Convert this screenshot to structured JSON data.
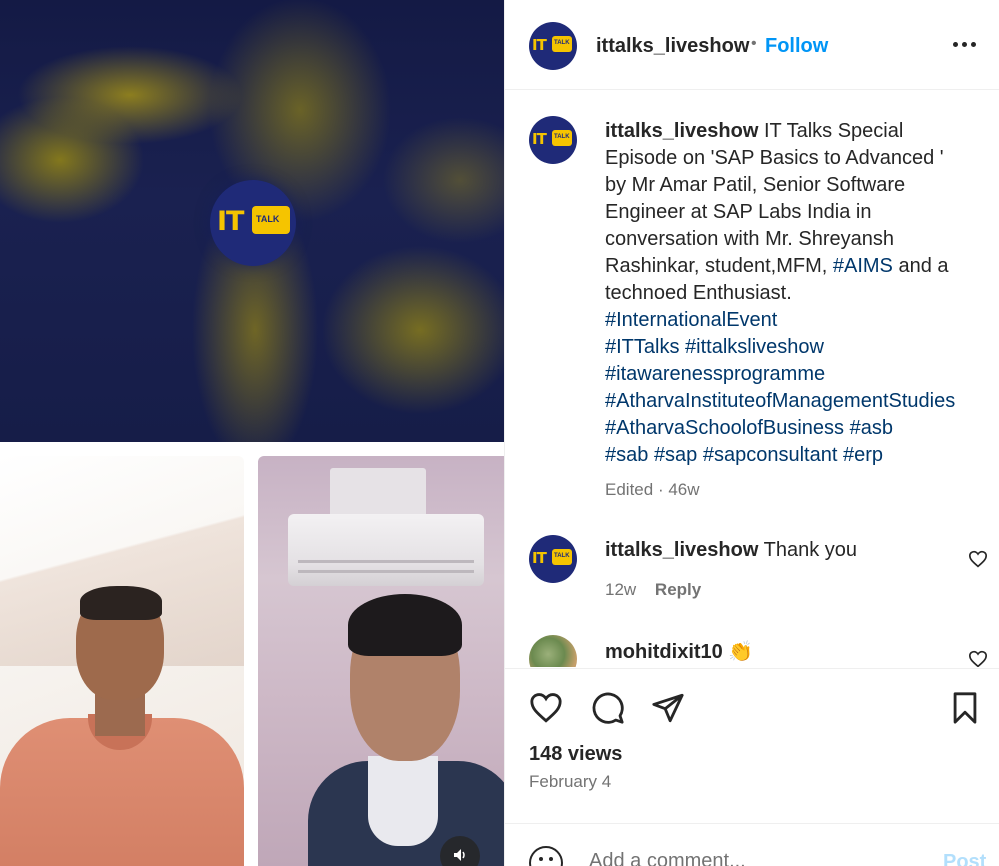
{
  "media": {
    "logo_word": "IT",
    "logo_bubble": "TALK",
    "mute_icon": "speaker-icon"
  },
  "header": {
    "username": "ittalks_liveshow",
    "separator": "•",
    "follow_label": "Follow",
    "more_icon": "more-options-icon"
  },
  "caption": {
    "username": "ittalks_liveshow",
    "text_part1": " IT Talks Special Episode on 'SAP Basics to Advanced ' by Mr Amar Patil, Senior Software Engineer at SAP Labs India in conversation with Mr. Shreyansh Rashinkar, student,MFM, ",
    "tag_aims": "#AIMS",
    "text_part2": " and a technoed Enthusiast.",
    "hashtags": [
      "#InternationalEvent",
      "#ITTalks",
      "#ittalksliveshow",
      "#itawarenessprogramme",
      "#AtharvaInstituteofManagementStudies",
      "#AtharvaSchoolofBusiness",
      "#asb",
      "#sab",
      "#sap",
      "#sapconsultant",
      "#erp"
    ],
    "edited": "Edited",
    "meta_sep": "·",
    "age": "46w"
  },
  "comments": [
    {
      "username": "ittalks_liveshow",
      "text": "Thank you",
      "age": "12w",
      "reply_label": "Reply"
    },
    {
      "username": "mohitdixit10",
      "text": "👏"
    }
  ],
  "actions": {
    "views": "148 views",
    "date": "February 4"
  },
  "add_comment": {
    "placeholder": "Add a comment...",
    "post_label": "Post"
  },
  "colors": {
    "link": "#0095f6",
    "hashtag": "#00376b",
    "muted": "#737373",
    "text": "#262626",
    "brand_navy": "#1f2a78",
    "brand_yellow": "#f5c400"
  }
}
